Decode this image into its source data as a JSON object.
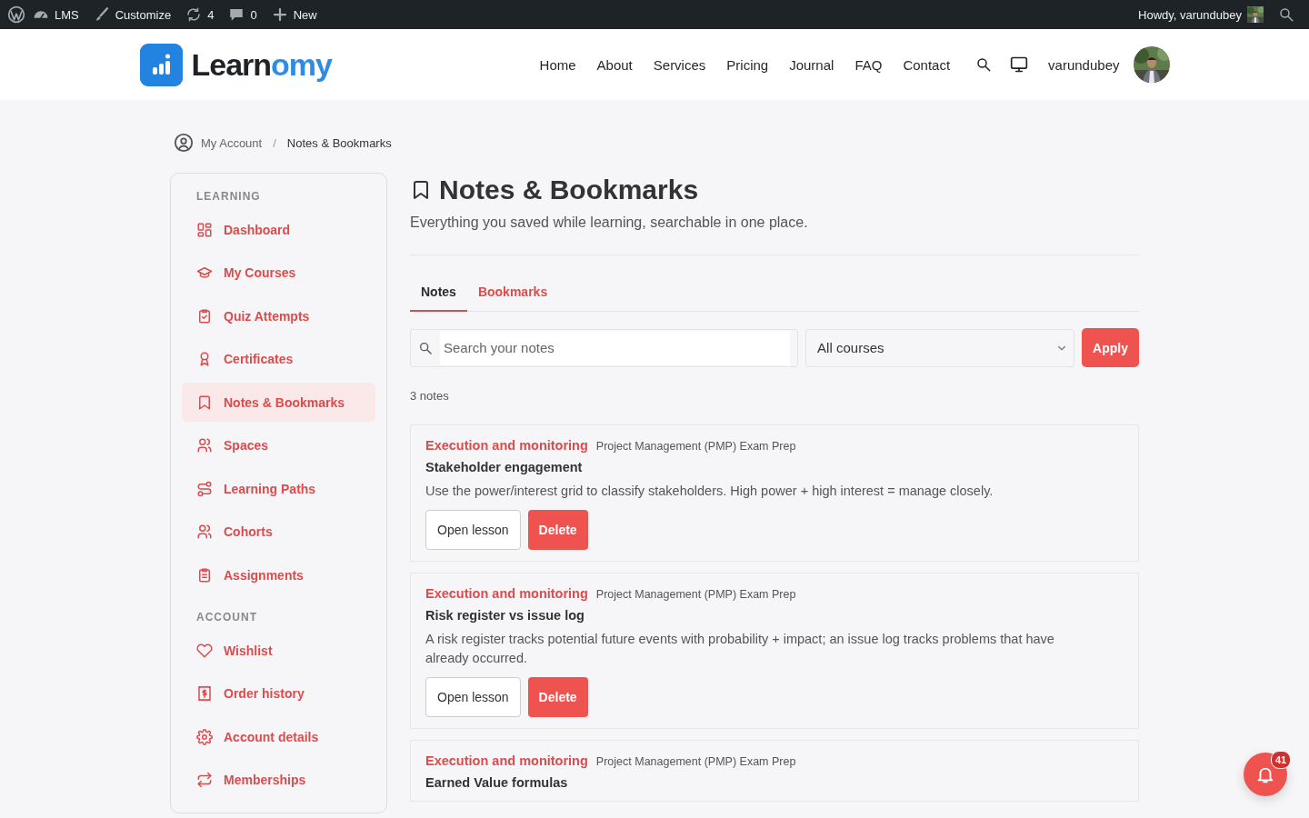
{
  "admin_bar": {
    "items": [
      {
        "label": "LMS"
      },
      {
        "label": "Customize"
      },
      {
        "label": "4"
      },
      {
        "label": "0"
      },
      {
        "label": "New"
      }
    ],
    "greeting": "Howdy, varundubey"
  },
  "header": {
    "logo": {
      "dark": "Learn",
      "accent": "omy"
    },
    "nav": [
      "Home",
      "About",
      "Services",
      "Pricing",
      "Journal",
      "FAQ",
      "Contact"
    ],
    "username": "varundubey"
  },
  "breadcrumb": {
    "items": [
      "My Account",
      "Notes & Bookmarks"
    ],
    "separator": "/"
  },
  "sidebar": {
    "sections": [
      {
        "heading": "LEARNING",
        "items": [
          {
            "label": "Dashboard",
            "selected": false
          },
          {
            "label": "My Courses",
            "selected": false
          },
          {
            "label": "Quiz Attempts",
            "selected": false
          },
          {
            "label": "Certificates",
            "selected": false
          },
          {
            "label": "Notes & Bookmarks",
            "selected": true
          },
          {
            "label": "Spaces",
            "selected": false
          },
          {
            "label": "Learning Paths",
            "selected": false
          },
          {
            "label": "Cohorts",
            "selected": false
          },
          {
            "label": "Assignments",
            "selected": false
          }
        ]
      },
      {
        "heading": "ACCOUNT",
        "items": [
          {
            "label": "Wishlist",
            "selected": false
          },
          {
            "label": "Order history",
            "selected": false
          },
          {
            "label": "Account details",
            "selected": false
          },
          {
            "label": "Memberships",
            "selected": false
          }
        ]
      }
    ]
  },
  "page": {
    "title": "Notes & Bookmarks",
    "subtitle": "Everything you saved while learning, searchable in one place."
  },
  "tabs": [
    {
      "label": "Notes",
      "selected": true
    },
    {
      "label": "Bookmarks",
      "selected": false
    }
  ],
  "filters": {
    "search_placeholder": "Search your notes",
    "course_select": "All courses",
    "apply": "Apply"
  },
  "count": "3 notes",
  "notes": [
    {
      "module": "Execution and monitoring",
      "course": "Project Management (PMP) Exam Prep",
      "title": "Stakeholder engagement",
      "body": "Use the power/interest grid to classify stakeholders. High power + high interest = manage closely.",
      "actions": [
        "Open lesson",
        "Delete"
      ]
    },
    {
      "module": "Execution and monitoring",
      "course": "Project Management (PMP) Exam Prep",
      "title": "Risk register vs issue log",
      "body": "A risk register tracks potential future events with probability + impact; an issue log tracks problems that have already occurred.",
      "actions": [
        "Open lesson",
        "Delete"
      ]
    },
    {
      "module": "Execution and monitoring",
      "course": "Project Management (PMP) Exam Prep",
      "title": "Earned Value formulas"
    }
  ],
  "notification": {
    "count": "41"
  }
}
